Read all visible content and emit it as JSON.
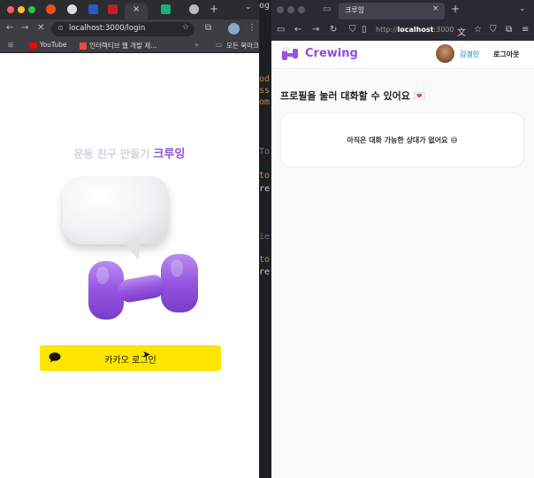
{
  "left_browser": {
    "tabs": [
      {
        "icon": "firefox-icon",
        "label": ""
      },
      {
        "icon": "github-icon",
        "label": ""
      },
      {
        "icon": "app-icon",
        "label": ""
      },
      {
        "icon": "app-icon",
        "label": ""
      },
      {
        "icon": "close-icon",
        "label": "×"
      },
      {
        "icon": "app-icon",
        "label": ""
      },
      {
        "icon": "chatgpt-icon",
        "label": ""
      }
    ],
    "new_tab": "+",
    "url": "localhost:3000/login",
    "bookmarks": [
      "YouTube",
      "인터렉티브 웹 개발 제...",
      "모든 북마크"
    ]
  },
  "left_page": {
    "title_prefix": "운동 친구 만들기",
    "title_brand": "크루잉",
    "kakao_button": "카카오 로그인"
  },
  "middle_code": [
    "og",
    "od",
    "ss",
    "om",
    "To",
    "to",
    "re",
    "ie",
    "to",
    "re"
  ],
  "right_browser": {
    "tab_label": "크루잉",
    "new_tab": "+",
    "url_prefix": "http://",
    "url_host": "localhost",
    "url_port": ":3000"
  },
  "right_page": {
    "brand": "Crewing",
    "user_name": "김경민",
    "logout": "로그아웃",
    "heading": "프로필을 눌러 대화할 수 있어요",
    "heading_emoji": "💌",
    "empty_message": "아직은 대화 가능한 상대가 없어요",
    "empty_emoji": "😅"
  },
  "colors": {
    "brand": "#8f4fd8",
    "kakao": "#fee500",
    "user_name": "#5ca8e8"
  }
}
